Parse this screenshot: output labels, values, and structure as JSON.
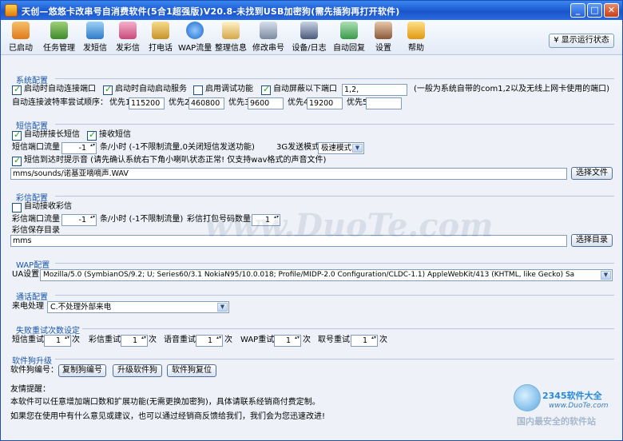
{
  "window": {
    "title": "天创—悠悠卡改串号自消费软件(5合1超强版)V20.8-未找到USB加密狗(需先插狗再打开软件)",
    "min": "_",
    "max": "□",
    "close": "✕"
  },
  "toolbar": {
    "items": [
      {
        "label": "已启动",
        "icon": "start-icon",
        "color": "#e98a2a"
      },
      {
        "label": "任务管理",
        "icon": "task-icon",
        "color": "#4f9a3a"
      },
      {
        "label": "发短信",
        "icon": "sms-icon",
        "color": "#3e8fd6"
      },
      {
        "label": "发彩信",
        "icon": "mms-icon",
        "color": "#d65a8a"
      },
      {
        "label": "打电话",
        "icon": "phone-icon",
        "color": "#d6a22e"
      },
      {
        "label": "WAP流量",
        "icon": "wap-icon",
        "color": "#2a7bd6"
      },
      {
        "label": "整理信息",
        "icon": "organize-icon",
        "color": "#d4b05a"
      },
      {
        "label": "修改串号",
        "icon": "edit-imei-icon",
        "color": "#7a8aa0"
      },
      {
        "label": "设备/日志",
        "icon": "device-log-icon",
        "color": "#5a6a86"
      },
      {
        "label": "自动回复",
        "icon": "auto-reply-icon",
        "color": "#4aa55a"
      },
      {
        "label": "设置",
        "icon": "settings-icon",
        "color": "#a06a3a"
      },
      {
        "label": "帮助",
        "icon": "help-icon",
        "color": "#e0a020"
      }
    ],
    "show_log": "显示运行状态"
  },
  "system": {
    "title": "系统配置",
    "auto_connect": "启动时自动连接端口",
    "auto_service": "启动时自动启动服务",
    "debug": "启用调试功能",
    "mask_ports": "自动屏蔽以下端口",
    "mask_ports_value": "1,2,",
    "mask_note": "(一般为系统自带的com1,2以及无线上网卡使用的端口)",
    "baud_label": "自动连接波特率尝试顺序：",
    "p1": "优先1",
    "v1": "115200",
    "p2": "优先2",
    "v2": "460800",
    "p3": "优先3",
    "v3": "9600",
    "p4": "优先4",
    "v4": "19200",
    "p5": "优先5",
    "v5": ""
  },
  "sms": {
    "title": "短信配置",
    "auto_join": "自动拼接长短信",
    "receive": "接收短信",
    "flow_label": "短信端口流量",
    "flow_value": "-1",
    "flow_note": "条/小时 (-1不限制流量,0关闭短信发送功能)",
    "mode_label": "3G发送模式",
    "mode_value": "极速模式",
    "sound_label": "短信到达时提示音 (请先确认系统右下角小喇叭状态正常! 仅支持wav格式的声音文件)",
    "sound_path": "mms/sounds/诺基亚嘀嘀声.WAV",
    "choose_file": "选择文件"
  },
  "mms": {
    "title": "彩信配置",
    "auto_receive": "自动接收彩信",
    "flow_label": "彩信端口流量",
    "flow_value": "-1",
    "flow_note": "条/小时 (-1不限制流量)",
    "pack_label": "彩信打包号码数量",
    "pack_value": "1",
    "dir_label": "彩信保存目录",
    "dir_value": "mms",
    "choose_dir": "选择目录"
  },
  "wap": {
    "title": "WAP配置",
    "ua_label": "UA设置",
    "ua_value": "Mozilla/5.0 (SymbianOS/9.2; U; Series60/3.1 NokiaN95/10.0.018; Profile/MIDP-2.0 Configuration/CLDC-1.1) AppleWebKit/413 (KHTML, like Gecko) Sa"
  },
  "call": {
    "title": "通话配置",
    "incoming_label": "来电处理",
    "incoming_value": "C.不处理外部来电"
  },
  "retry": {
    "title": "失败重试次数设定",
    "sms_label": "短信重试",
    "sms_value": "1",
    "sms_unit": "次",
    "mms_label": "彩信重试",
    "mms_value": "1",
    "mms_unit": "次",
    "voice_label": "语音重试",
    "voice_value": "1",
    "voice_unit": "次",
    "wap_label": "WAP重试",
    "wap_value": "1",
    "wap_unit": "次",
    "num_label": "取号重试",
    "num_value": "1",
    "num_unit": "次"
  },
  "dongle": {
    "title": "软件狗升级",
    "id_label": "软件狗编号：",
    "copy": "复制狗编号",
    "upgrade": "升级软件狗",
    "reset": "软件狗复位"
  },
  "tips": {
    "title": "友情提醒：",
    "line1": "本软件可以任意增加端口数和扩展功能(无需更换加密狗)，具体请联系经销商付费定制。",
    "line2": "如果您在使用中有什么意见或建议，也可以通过经销商反馈给我们，我们会为您迅速改进!"
  },
  "overlay": {
    "watermark": "www.DuoTe.com",
    "logo_brand": "2345软件大全",
    "logo_url": "www.DuoTe.com",
    "logo_slogan": "国内最安全的软件站"
  }
}
